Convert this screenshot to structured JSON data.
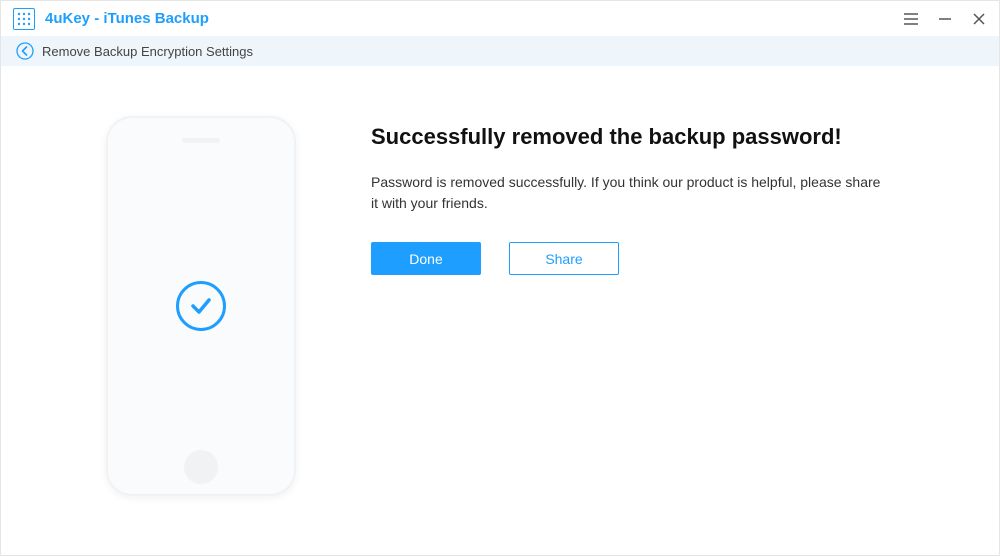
{
  "titlebar": {
    "app_title": "4uKey - iTunes Backup"
  },
  "breadcrumb": {
    "text": "Remove Backup Encryption Settings"
  },
  "content": {
    "heading": "Successfully removed the backup password!",
    "description": "Password is removed successfully. If you think our product is helpful, please share it with your friends.",
    "done_label": "Done",
    "share_label": "Share"
  }
}
